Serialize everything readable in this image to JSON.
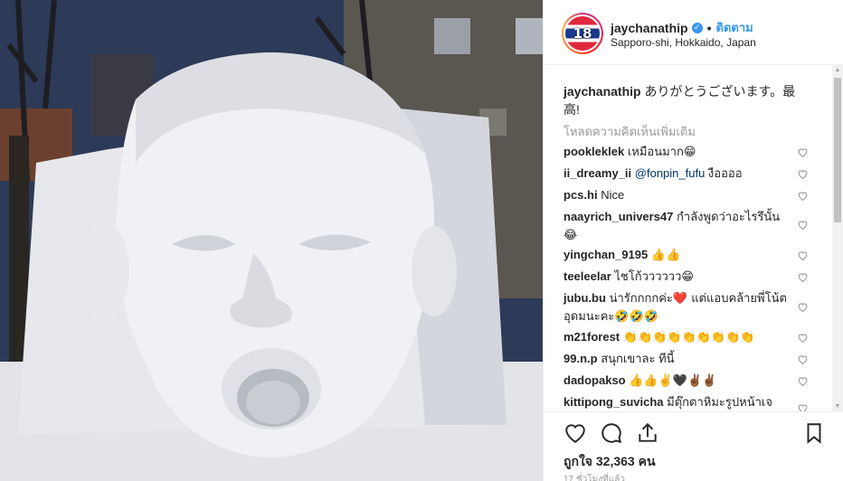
{
  "post": {
    "username": "jaychanathip",
    "follow_label": "ติดตาม",
    "location": "Sapporo-shi, Hokkaido, Japan",
    "avatar_text": "18",
    "caption_user": "jaychanathip",
    "caption_text": "ありがとうございます。最高!",
    "load_more_label": "โหลดความคิดเห็นเพิ่มเติม",
    "likes_label": "ถูกใจ 32,363 คน",
    "timestamp": "17 ชั่วโมงที่แล้ว"
  },
  "comments": [
    {
      "user": "pookleklek",
      "text": "เหมือนมาก😁"
    },
    {
      "user": "ii_dreamy_ii",
      "mention": "@fonpin_fufu",
      "text": " งืออออ"
    },
    {
      "user": "pcs.hi",
      "text": "Nice"
    },
    {
      "user": "naayrich_univers47",
      "text": "กำลังพูดว่าอะไรรึนั้น 😂"
    },
    {
      "user": "yingchan_9195",
      "text": "👍👍"
    },
    {
      "user": "teeleelar",
      "text": "ไชโก้วววววว😁"
    },
    {
      "user": "jubu.bu",
      "text": "น่ารักกกกค่ะ❤️ แต่แอบคล้ายพี่โน้ตอุดมนะคะ🤣🤣🤣"
    },
    {
      "user": "m21forest",
      "text": "👏👏👏👏👏👏👏👏👏"
    },
    {
      "user": "99.n.p",
      "text": "สนุกเขาละ ทีนี้"
    },
    {
      "user": "dadopakso",
      "text": "👍👍✌️🖤✌🏾✌🏾"
    },
    {
      "user": "kittipong_suvicha",
      "text": "มีตุ๊กตาหิมะรูปหน้าเจ"
    }
  ],
  "icons": {
    "verified": "verified-badge-icon",
    "heart": "heart-icon",
    "comment": "comment-icon",
    "share": "share-icon",
    "bookmark": "bookmark-icon"
  },
  "colors": {
    "accent": "#3897f0",
    "text": "#262626",
    "muted": "#999999"
  }
}
